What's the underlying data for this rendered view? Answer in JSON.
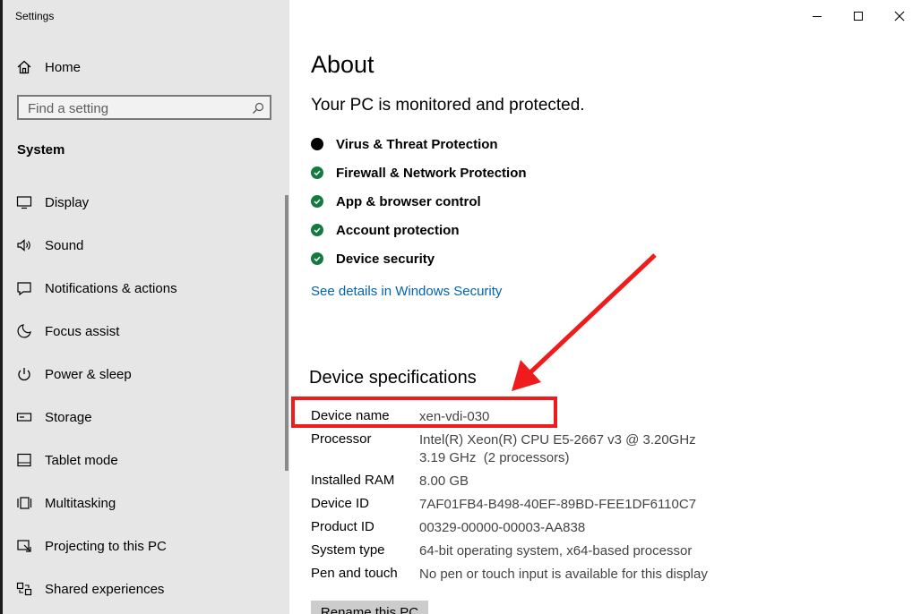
{
  "window": {
    "title": "Settings",
    "controls": {
      "minimize": "minimize-icon",
      "maximize": "maximize-icon",
      "close": "close-icon"
    }
  },
  "sidebar": {
    "home_label": "Home",
    "search": {
      "placeholder": "Find a setting"
    },
    "section_title": "System",
    "items": [
      {
        "label": "Display",
        "icon": "monitor-icon"
      },
      {
        "label": "Sound",
        "icon": "speaker-icon"
      },
      {
        "label": "Notifications & actions",
        "icon": "notification-icon"
      },
      {
        "label": "Focus assist",
        "icon": "moon-icon"
      },
      {
        "label": "Power & sleep",
        "icon": "power-icon"
      },
      {
        "label": "Storage",
        "icon": "storage-icon"
      },
      {
        "label": "Tablet mode",
        "icon": "tablet-icon"
      },
      {
        "label": "Multitasking",
        "icon": "multitasking-icon"
      },
      {
        "label": "Projecting to this PC",
        "icon": "projector-icon"
      },
      {
        "label": "Shared experiences",
        "icon": "shared-icon"
      }
    ]
  },
  "main": {
    "title": "About",
    "protection_heading": "Your PC is monitored and protected.",
    "protections": [
      {
        "label": "Virus & Threat Protection",
        "status": "unknown"
      },
      {
        "label": "Firewall & Network Protection",
        "status": "ok"
      },
      {
        "label": "App & browser control",
        "status": "ok"
      },
      {
        "label": "Account protection",
        "status": "ok"
      },
      {
        "label": "Device security",
        "status": "ok"
      }
    ],
    "security_link": "See details in Windows Security",
    "specs_heading": "Device specifications",
    "specs": {
      "device_name": {
        "label": "Device name",
        "value": "xen-vdi-030"
      },
      "processor": {
        "label": "Processor",
        "value_line1": "Intel(R) Xeon(R) CPU E5-2667 v3 @ 3.20GHz",
        "value_line2": "3.19 GHz  (2 processors)"
      },
      "ram": {
        "label": "Installed RAM",
        "value": "8.00 GB"
      },
      "device_id": {
        "label": "Device ID",
        "value": "7AF01FB4-B498-40EF-89BD-FEE1DF6110C7"
      },
      "product_id": {
        "label": "Product ID",
        "value": "00329-00000-00003-AA838"
      },
      "system_type": {
        "label": "System type",
        "value": "64-bit operating system, x64-based processor"
      },
      "pen_touch": {
        "label": "Pen and touch",
        "value": "No pen or touch input is available for this display"
      }
    },
    "rename_button": "Rename this PC"
  },
  "colors": {
    "accent_link": "#0063b1",
    "ok_green": "#107c41",
    "unknown_black": "#000000",
    "annotation_red": "#ee1c1c"
  }
}
